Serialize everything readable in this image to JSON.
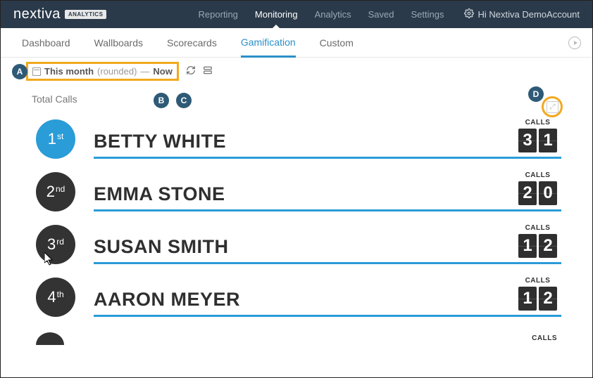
{
  "brand": {
    "name": "nextiva",
    "badge": "ANALYTICS"
  },
  "topnav": {
    "items": [
      "Reporting",
      "Monitoring",
      "Analytics",
      "Saved",
      "Settings"
    ],
    "active": "Monitoring"
  },
  "account": {
    "greeting": "Hi Nextiva DemoAccount"
  },
  "subnav": {
    "items": [
      "Dashboard",
      "Wallboards",
      "Scorecards",
      "Gamification",
      "Custom"
    ],
    "active": "Gamification"
  },
  "filter": {
    "range_label": "This month",
    "range_modifier": "(rounded)",
    "separator": "—",
    "now_label": "Now"
  },
  "section": {
    "title": "Total Calls"
  },
  "leaderboard": {
    "metric_label": "CALLS",
    "rows": [
      {
        "rank_main": "1",
        "rank_ord": "st",
        "name": "BETTY WHITE",
        "digits": [
          "3",
          "1"
        ],
        "color": "blue"
      },
      {
        "rank_main": "2",
        "rank_ord": "nd",
        "name": "EMMA STONE",
        "digits": [
          "2",
          "0"
        ],
        "color": "dark"
      },
      {
        "rank_main": "3",
        "rank_ord": "rd",
        "name": "SUSAN SMITH",
        "digits": [
          "1",
          "2"
        ],
        "color": "dark"
      },
      {
        "rank_main": "4",
        "rank_ord": "th",
        "name": "AARON MEYER",
        "digits": [
          "1",
          "2"
        ],
        "color": "dark"
      }
    ]
  },
  "callouts": {
    "a": "A",
    "b": "B",
    "c": "C",
    "d": "D"
  }
}
